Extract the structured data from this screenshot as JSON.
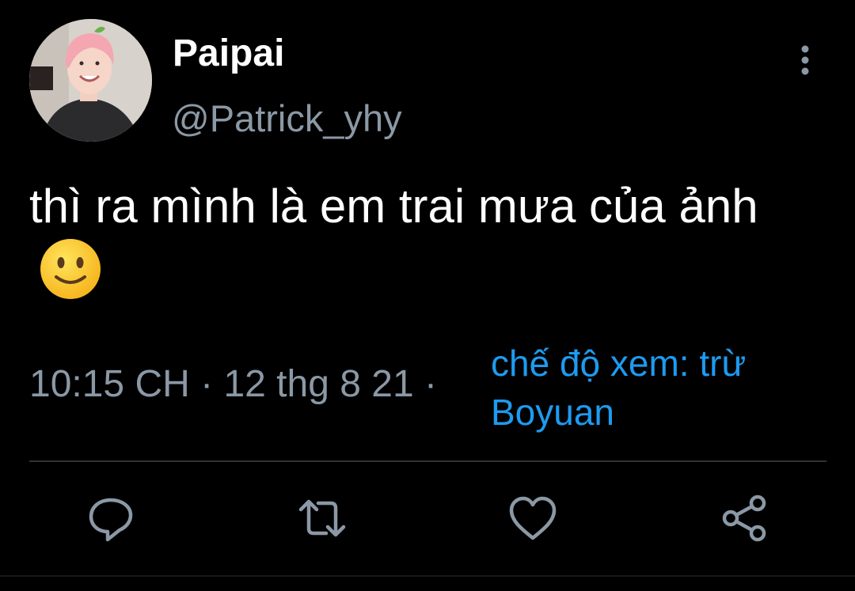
{
  "tweet": {
    "author": {
      "display_name": "Paipai",
      "handle": "@Patrick_yhy"
    },
    "text": "thì ra mình là em trai mưa của ảnh",
    "emoji": "slightly-smiling-face",
    "timestamp": "10:15 CH · 12 thg 8 21 ·",
    "source": "chế độ xem: trừ Boyuan"
  },
  "icons": {
    "more": "more-vertical-icon",
    "reply": "reply-icon",
    "retweet": "retweet-icon",
    "like": "like-icon",
    "share": "share-icon"
  },
  "colors": {
    "background": "#000000",
    "text_primary": "#ffffff",
    "text_secondary": "#8b98a5",
    "link": "#1d9bf0",
    "divider": "#2f3336",
    "icon": "#8b98a5"
  }
}
